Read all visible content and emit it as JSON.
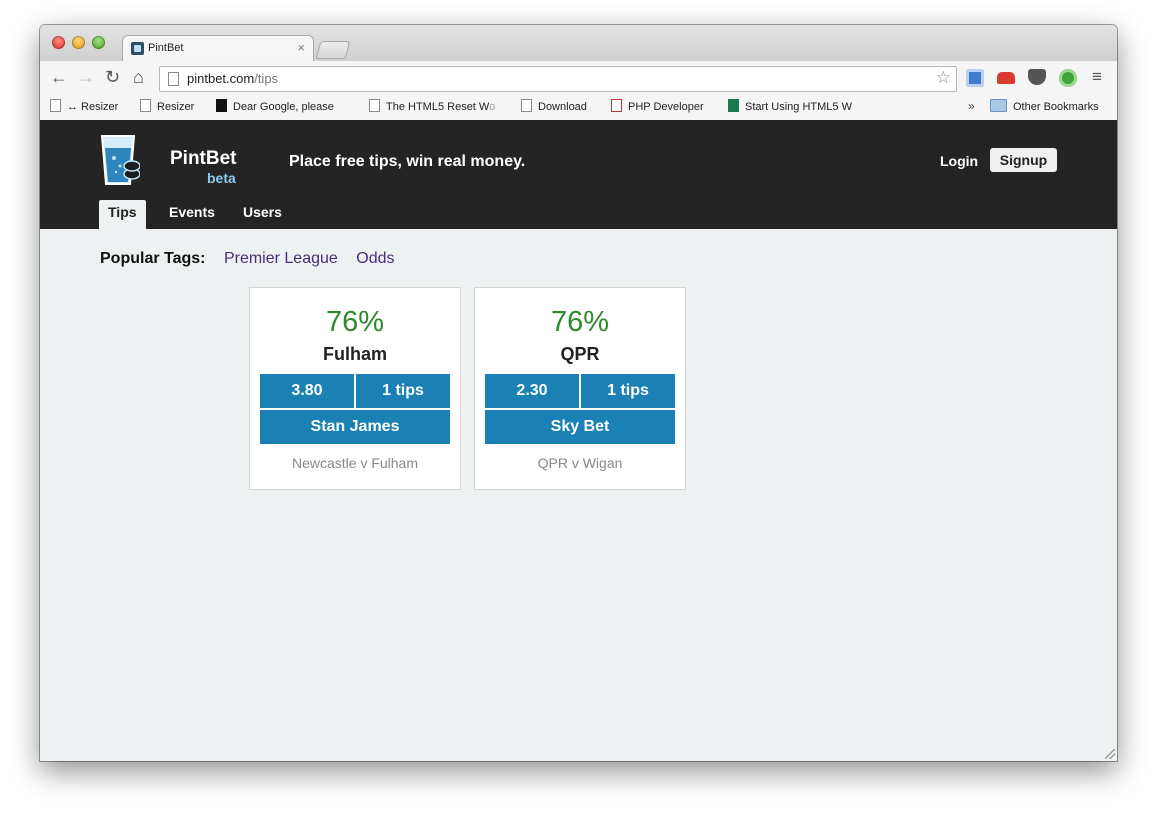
{
  "browser": {
    "tab_title": "PintBet",
    "tab_close": "×",
    "url_host": "pintbet.com",
    "url_path": "/tips",
    "nav": {
      "back": "←",
      "forward": "→",
      "reload": "↻",
      "home": "⌂"
    },
    "star": "☆",
    "menu": "≡",
    "bookmarks": [
      {
        "label": "↔ Resizer",
        "fade": "",
        "icon": "page-icon"
      },
      {
        "label": "Resizer",
        "fade": "",
        "icon": "page-icon"
      },
      {
        "label": "Dear Google, please",
        "fade": "",
        "icon": "dark-icon"
      },
      {
        "label": "The HTML5 Reset W",
        "fade": "o",
        "icon": "page-icon"
      },
      {
        "label": "Download",
        "fade": "",
        "icon": "page-icon"
      },
      {
        "label": "PHP Developer",
        "fade": "",
        "icon": "red-icon"
      },
      {
        "label": "Start Using HTML5 W",
        "fade": "",
        "icon": "green-icon"
      }
    ],
    "bookmarks_more": "»",
    "other_bookmarks": "Other Bookmarks"
  },
  "site": {
    "brand": "PintBet",
    "beta": "beta",
    "tagline": "Place free tips, win real money.",
    "login": "Login",
    "signup": "Signup",
    "nav": [
      "Tips",
      "Events",
      "Users"
    ],
    "active_nav": "Tips"
  },
  "popular_tags": {
    "label": "Popular Tags:",
    "tags": [
      "Premier League",
      "Odds"
    ]
  },
  "tips": [
    {
      "percent": "76%",
      "team": "Fulham",
      "odds": "3.80",
      "tips": "1 tips",
      "bookie": "Stan James",
      "event": "Newcastle v Fulham"
    },
    {
      "percent": "76%",
      "team": "QPR",
      "odds": "2.30",
      "tips": "1 tips",
      "bookie": "Sky Bet",
      "event": "QPR v Wigan"
    }
  ],
  "colors": {
    "header_bg": "#242424",
    "accent_blue": "#1b80b3",
    "percent_green": "#2b8a2b",
    "tag_purple": "#4a2c7a",
    "page_bg": "#eef1f2"
  }
}
